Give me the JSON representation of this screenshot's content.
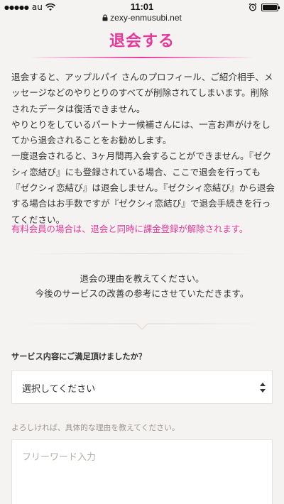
{
  "status_bar": {
    "signal": "●●●●●",
    "carrier": "au",
    "time": "11:01"
  },
  "browser": {
    "url": "zexy-enmusubi.net"
  },
  "page": {
    "title": "退会する",
    "description": [
      "退会すると、アップルパイ さんのプロフィール、ご紹介相手、メッセージなどのやりとりのすべてが削除されてしまいます。削除されたデータは復活できません。",
      "やりとりをしているパートナー候補さんには、一言お声がけをしてから退会されることをお勧めします。",
      "一度退会されると、3ヶ月間再入会することができません。『ゼクシィ恋結び』にも登録されている場合、ここで退会を行っても『ゼクシィ恋結び』は退会しません。『ゼクシィ恋結び』から退会する場合はお手数ですが『ゼクシィ恋結び』で退会手続きを行ってください。"
    ],
    "warning": "有料会員の場合は、退会と同時に課金登録が解除されます。",
    "reason_intro_line1": "退会の理由を教えてください。",
    "reason_intro_line2": "今後のサービスの改善の参考にさせていただきます。"
  },
  "form": {
    "satisfaction_question": "サービス内容にご満足頂けましたか？",
    "satisfaction_select": {
      "selected": "選択してください"
    },
    "reason_hint": "よろしければ、具体的な理由を教えてください。",
    "reason_placeholder": "フリーワード入力"
  },
  "colors": {
    "accent": "#e6399b",
    "background": "#f5f3f1"
  }
}
